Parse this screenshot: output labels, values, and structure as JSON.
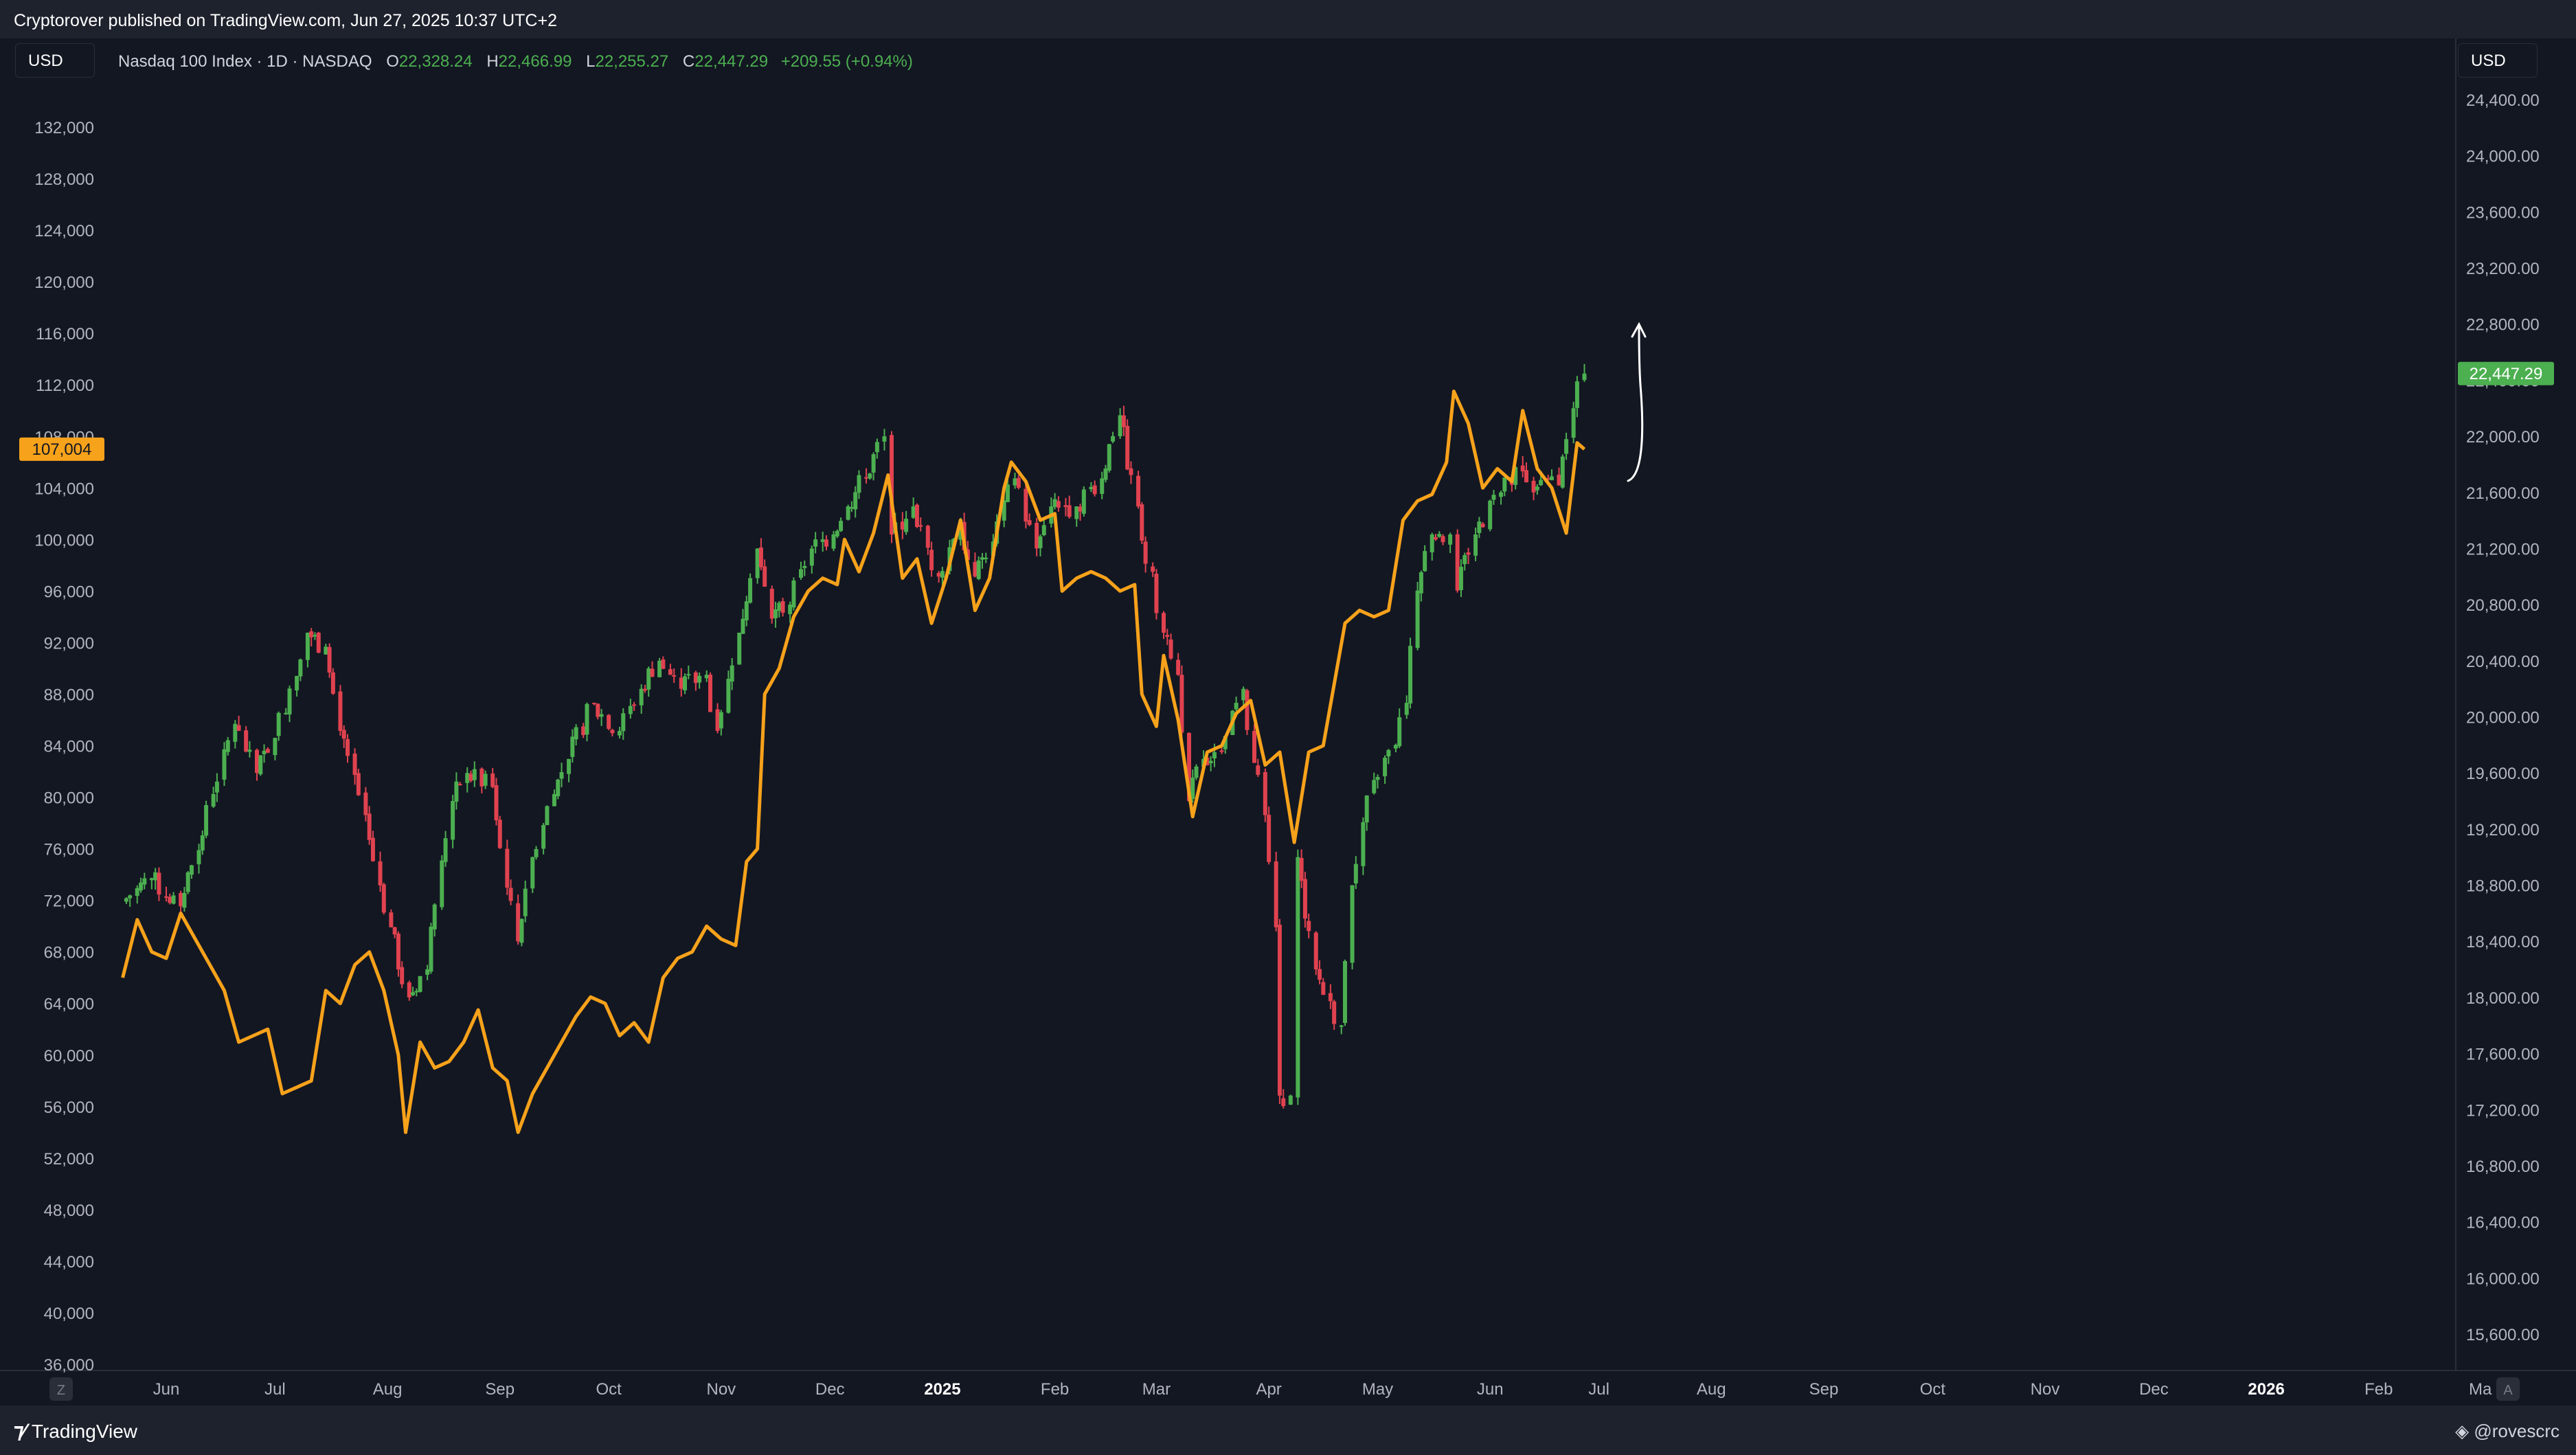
{
  "header": {
    "published_line": "Cryptorover published on TradingView.com, Jun 27, 2025 10:37 UTC+2"
  },
  "legend": {
    "symbol": "Nasdaq 100 Index · 1D · NASDAQ",
    "open_label": "O",
    "open": "22,328.24",
    "high_label": "H",
    "high": "22,466.99",
    "low_label": "L",
    "low": "22,255.27",
    "close_label": "C",
    "close": "22,447.29",
    "change": "+209.55 (+0.94%)"
  },
  "currency_left": "USD",
  "currency_right": "USD",
  "footer": {
    "brand": "TradingView",
    "author": "@rovescrc",
    "z_button": "Z",
    "a_button": "A"
  },
  "colors": {
    "background": "#131722",
    "orange_line": "#f7a21b",
    "candle_up": "#4caf50",
    "candle_down": "#e0424f",
    "price_label": "#4caf50",
    "left_label": "#f7a21b"
  },
  "chart_data": {
    "type": "line",
    "time_axis": {
      "labels": [
        "Jun",
        "Jul",
        "Aug",
        "Sep",
        "Oct",
        "Nov",
        "Dec",
        "2025",
        "Feb",
        "Mar",
        "Apr",
        "May",
        "Jun",
        "Jul",
        "Aug",
        "Sep",
        "Oct",
        "Nov",
        "Dec",
        "2026",
        "Feb",
        "Ma"
      ],
      "bold_labels": [
        "2025",
        "2026"
      ]
    },
    "left_axis": {
      "ticks": [
        "36,000",
        "40,000",
        "44,000",
        "48,000",
        "52,000",
        "56,000",
        "60,000",
        "64,000",
        "68,000",
        "72,000",
        "76,000",
        "80,000",
        "84,000",
        "88,000",
        "92,000",
        "96,000",
        "100,000",
        "104,000",
        "108,000",
        "112,000",
        "116,000",
        "120,000",
        "124,000",
        "128,000",
        "132,000"
      ],
      "range": [
        36000,
        136000
      ],
      "current_value_label": "107,004"
    },
    "right_axis": {
      "ticks": [
        "15,600.00",
        "16,000.00",
        "16,400.00",
        "16,800.00",
        "17,200.00",
        "17,600.00",
        "18,000.00",
        "18,400.00",
        "18,800.00",
        "19,200.00",
        "19,600.00",
        "20,000.00",
        "20,400.00",
        "20,800.00",
        "21,200.00",
        "21,600.00",
        "22,000.00",
        "22,400.00",
        "22,800.00",
        "23,200.00",
        "23,600.00",
        "24,000.00",
        "24,400.00"
      ],
      "range": [
        15400,
        24640
      ],
      "current_value_label": "22,447.29"
    },
    "series": [
      {
        "axis": "left",
        "style": "line",
        "values": [
          {
            "date": "2024-05-20",
            "value": 66000
          },
          {
            "date": "2024-05-24",
            "value": 70500
          },
          {
            "date": "2024-05-28",
            "value": 68000
          },
          {
            "date": "2024-06-01",
            "value": 67500
          },
          {
            "date": "2024-06-05",
            "value": 71000
          },
          {
            "date": "2024-06-09",
            "value": 69000
          },
          {
            "date": "2024-06-13",
            "value": 67000
          },
          {
            "date": "2024-06-17",
            "value": 65000
          },
          {
            "date": "2024-06-21",
            "value": 61000
          },
          {
            "date": "2024-06-25",
            "value": 61500
          },
          {
            "date": "2024-06-29",
            "value": 62000
          },
          {
            "date": "2024-07-03",
            "value": 57000
          },
          {
            "date": "2024-07-07",
            "value": 57500
          },
          {
            "date": "2024-07-11",
            "value": 58000
          },
          {
            "date": "2024-07-15",
            "value": 65000
          },
          {
            "date": "2024-07-19",
            "value": 64000
          },
          {
            "date": "2024-07-23",
            "value": 67000
          },
          {
            "date": "2024-07-27",
            "value": 68000
          },
          {
            "date": "2024-07-31",
            "value": 65000
          },
          {
            "date": "2024-08-04",
            "value": 60000
          },
          {
            "date": "2024-08-06",
            "value": 54000
          },
          {
            "date": "2024-08-10",
            "value": 61000
          },
          {
            "date": "2024-08-14",
            "value": 59000
          },
          {
            "date": "2024-08-18",
            "value": 59500
          },
          {
            "date": "2024-08-22",
            "value": 61000
          },
          {
            "date": "2024-08-26",
            "value": 63500
          },
          {
            "date": "2024-08-30",
            "value": 59000
          },
          {
            "date": "2024-09-03",
            "value": 58000
          },
          {
            "date": "2024-09-06",
            "value": 54000
          },
          {
            "date": "2024-09-10",
            "value": 57000
          },
          {
            "date": "2024-09-14",
            "value": 59000
          },
          {
            "date": "2024-09-18",
            "value": 61000
          },
          {
            "date": "2024-09-22",
            "value": 63000
          },
          {
            "date": "2024-09-26",
            "value": 64500
          },
          {
            "date": "2024-09-30",
            "value": 64000
          },
          {
            "date": "2024-10-04",
            "value": 61500
          },
          {
            "date": "2024-10-08",
            "value": 62500
          },
          {
            "date": "2024-10-12",
            "value": 61000
          },
          {
            "date": "2024-10-16",
            "value": 66000
          },
          {
            "date": "2024-10-20",
            "value": 67500
          },
          {
            "date": "2024-10-24",
            "value": 68000
          },
          {
            "date": "2024-10-28",
            "value": 70000
          },
          {
            "date": "2024-11-01",
            "value": 69000
          },
          {
            "date": "2024-11-05",
            "value": 68500
          },
          {
            "date": "2024-11-08",
            "value": 75000
          },
          {
            "date": "2024-11-11",
            "value": 76000
          },
          {
            "date": "2024-11-13",
            "value": 88000
          },
          {
            "date": "2024-11-17",
            "value": 90000
          },
          {
            "date": "2024-11-21",
            "value": 94000
          },
          {
            "date": "2024-11-25",
            "value": 96000
          },
          {
            "date": "2024-11-29",
            "value": 97000
          },
          {
            "date": "2024-12-03",
            "value": 96500
          },
          {
            "date": "2024-12-05",
            "value": 100000
          },
          {
            "date": "2024-12-09",
            "value": 97500
          },
          {
            "date": "2024-12-13",
            "value": 100500
          },
          {
            "date": "2024-12-17",
            "value": 105000
          },
          {
            "date": "2024-12-21",
            "value": 97000
          },
          {
            "date": "2024-12-25",
            "value": 98500
          },
          {
            "date": "2024-12-29",
            "value": 93500
          },
          {
            "date": "2025-01-02",
            "value": 97000
          },
          {
            "date": "2025-01-06",
            "value": 101500
          },
          {
            "date": "2025-01-10",
            "value": 94500
          },
          {
            "date": "2025-01-14",
            "value": 97000
          },
          {
            "date": "2025-01-18",
            "value": 104000
          },
          {
            "date": "2025-01-20",
            "value": 106000
          },
          {
            "date": "2025-01-24",
            "value": 104500
          },
          {
            "date": "2025-01-28",
            "value": 101500
          },
          {
            "date": "2025-02-01",
            "value": 102000
          },
          {
            "date": "2025-02-03",
            "value": 96000
          },
          {
            "date": "2025-02-07",
            "value": 97000
          },
          {
            "date": "2025-02-11",
            "value": 97500
          },
          {
            "date": "2025-02-15",
            "value": 97000
          },
          {
            "date": "2025-02-19",
            "value": 96000
          },
          {
            "date": "2025-02-23",
            "value": 96500
          },
          {
            "date": "2025-02-25",
            "value": 88000
          },
          {
            "date": "2025-03-01",
            "value": 85500
          },
          {
            "date": "2025-03-03",
            "value": 91000
          },
          {
            "date": "2025-03-07",
            "value": 86000
          },
          {
            "date": "2025-03-11",
            "value": 78500
          },
          {
            "date": "2025-03-15",
            "value": 83500
          },
          {
            "date": "2025-03-19",
            "value": 84000
          },
          {
            "date": "2025-03-23",
            "value": 86500
          },
          {
            "date": "2025-03-27",
            "value": 87500
          },
          {
            "date": "2025-03-31",
            "value": 82500
          },
          {
            "date": "2025-04-04",
            "value": 83500
          },
          {
            "date": "2025-04-08",
            "value": 76500
          },
          {
            "date": "2025-04-12",
            "value": 83500
          },
          {
            "date": "2025-04-16",
            "value": 84000
          },
          {
            "date": "2025-04-22",
            "value": 93500
          },
          {
            "date": "2025-04-26",
            "value": 94500
          },
          {
            "date": "2025-04-30",
            "value": 94000
          },
          {
            "date": "2025-05-04",
            "value": 94500
          },
          {
            "date": "2025-05-08",
            "value": 101500
          },
          {
            "date": "2025-05-12",
            "value": 103000
          },
          {
            "date": "2025-05-16",
            "value": 103500
          },
          {
            "date": "2025-05-20",
            "value": 106000
          },
          {
            "date": "2025-05-22",
            "value": 111500
          },
          {
            "date": "2025-05-26",
            "value": 109000
          },
          {
            "date": "2025-05-30",
            "value": 104000
          },
          {
            "date": "2025-06-03",
            "value": 105500
          },
          {
            "date": "2025-06-07",
            "value": 104500
          },
          {
            "date": "2025-06-10",
            "value": 110000
          },
          {
            "date": "2025-06-14",
            "value": 105500
          },
          {
            "date": "2025-06-18",
            "value": 104000
          },
          {
            "date": "2025-06-22",
            "value": 100500
          },
          {
            "date": "2025-06-25",
            "value": 107500
          },
          {
            "date": "2025-06-27",
            "value": 107004
          }
        ]
      },
      {
        "axis": "right",
        "style": "candlestick",
        "values": [
          {
            "date": "2024-05-20",
            "value": 18680
          },
          {
            "date": "2024-05-28",
            "value": 18850
          },
          {
            "date": "2024-06-05",
            "value": 18650
          },
          {
            "date": "2024-06-10",
            "value": 19050
          },
          {
            "date": "2024-06-14",
            "value": 19450
          },
          {
            "date": "2024-06-20",
            "value": 19950
          },
          {
            "date": "2024-06-26",
            "value": 19600
          },
          {
            "date": "2024-07-01",
            "value": 19850
          },
          {
            "date": "2024-07-10",
            "value": 20600
          },
          {
            "date": "2024-07-15",
            "value": 20500
          },
          {
            "date": "2024-07-19",
            "value": 19900
          },
          {
            "date": "2024-07-26",
            "value": 19300
          },
          {
            "date": "2024-08-02",
            "value": 18500
          },
          {
            "date": "2024-08-07",
            "value": 18000
          },
          {
            "date": "2024-08-12",
            "value": 18200
          },
          {
            "date": "2024-08-19",
            "value": 19400
          },
          {
            "date": "2024-08-23",
            "value": 19600
          },
          {
            "date": "2024-08-30",
            "value": 19500
          },
          {
            "date": "2024-09-06",
            "value": 18400
          },
          {
            "date": "2024-09-10",
            "value": 19000
          },
          {
            "date": "2024-09-16",
            "value": 19450
          },
          {
            "date": "2024-09-20",
            "value": 19700
          },
          {
            "date": "2024-09-27",
            "value": 20100
          },
          {
            "date": "2024-10-04",
            "value": 19900
          },
          {
            "date": "2024-10-10",
            "value": 20200
          },
          {
            "date": "2024-10-15",
            "value": 20400
          },
          {
            "date": "2024-10-21",
            "value": 20200
          },
          {
            "date": "2024-10-28",
            "value": 20300
          },
          {
            "date": "2024-10-31",
            "value": 19900
          },
          {
            "date": "2024-11-06",
            "value": 20600
          },
          {
            "date": "2024-11-11",
            "value": 21200
          },
          {
            "date": "2024-11-15",
            "value": 20700
          },
          {
            "date": "2024-11-20",
            "value": 20800
          },
          {
            "date": "2024-11-26",
            "value": 21200
          },
          {
            "date": "2024-12-02",
            "value": 21300
          },
          {
            "date": "2024-12-06",
            "value": 21500
          },
          {
            "date": "2024-12-11",
            "value": 21700
          },
          {
            "date": "2024-12-16",
            "value": 22000
          },
          {
            "date": "2024-12-18",
            "value": 21300
          },
          {
            "date": "2024-12-24",
            "value": 21500
          },
          {
            "date": "2024-12-31",
            "value": 21000
          },
          {
            "date": "2025-01-06",
            "value": 21400
          },
          {
            "date": "2025-01-10",
            "value": 21000
          },
          {
            "date": "2025-01-15",
            "value": 21250
          },
          {
            "date": "2025-01-21",
            "value": 21700
          },
          {
            "date": "2025-01-27",
            "value": 21200
          },
          {
            "date": "2025-01-31",
            "value": 21500
          },
          {
            "date": "2025-02-07",
            "value": 21500
          },
          {
            "date": "2025-02-14",
            "value": 21700
          },
          {
            "date": "2025-02-19",
            "value": 22150
          },
          {
            "date": "2025-02-24",
            "value": 21500
          },
          {
            "date": "2025-03-03",
            "value": 20600
          },
          {
            "date": "2025-03-07",
            "value": 20300
          },
          {
            "date": "2025-03-10",
            "value": 19400
          },
          {
            "date": "2025-03-14",
            "value": 19700
          },
          {
            "date": "2025-03-19",
            "value": 19750
          },
          {
            "date": "2025-03-25",
            "value": 20200
          },
          {
            "date": "2025-03-31",
            "value": 19300
          },
          {
            "date": "2025-04-03",
            "value": 18500
          },
          {
            "date": "2025-04-04",
            "value": 17300
          },
          {
            "date": "2025-04-07",
            "value": 17300
          },
          {
            "date": "2025-04-09",
            "value": 19000
          },
          {
            "date": "2025-04-14",
            "value": 18200
          },
          {
            "date": "2025-04-21",
            "value": 17800
          },
          {
            "date": "2025-04-24",
            "value": 18800
          },
          {
            "date": "2025-04-30",
            "value": 19550
          },
          {
            "date": "2025-05-06",
            "value": 19800
          },
          {
            "date": "2025-05-09",
            "value": 20100
          },
          {
            "date": "2025-05-12",
            "value": 20900
          },
          {
            "date": "2025-05-16",
            "value": 21300
          },
          {
            "date": "2025-05-21",
            "value": 21300
          },
          {
            "date": "2025-05-23",
            "value": 20900
          },
          {
            "date": "2025-05-28",
            "value": 21300
          },
          {
            "date": "2025-06-04",
            "value": 21600
          },
          {
            "date": "2025-06-10",
            "value": 21750
          },
          {
            "date": "2025-06-13",
            "value": 21600
          },
          {
            "date": "2025-06-17",
            "value": 21700
          },
          {
            "date": "2025-06-20",
            "value": 21650
          },
          {
            "date": "2025-06-24",
            "value": 22200
          },
          {
            "date": "2025-06-27",
            "value": 22447
          }
        ]
      }
    ],
    "annotation": "hand-drawn upward arrow",
    "grid": false
  }
}
